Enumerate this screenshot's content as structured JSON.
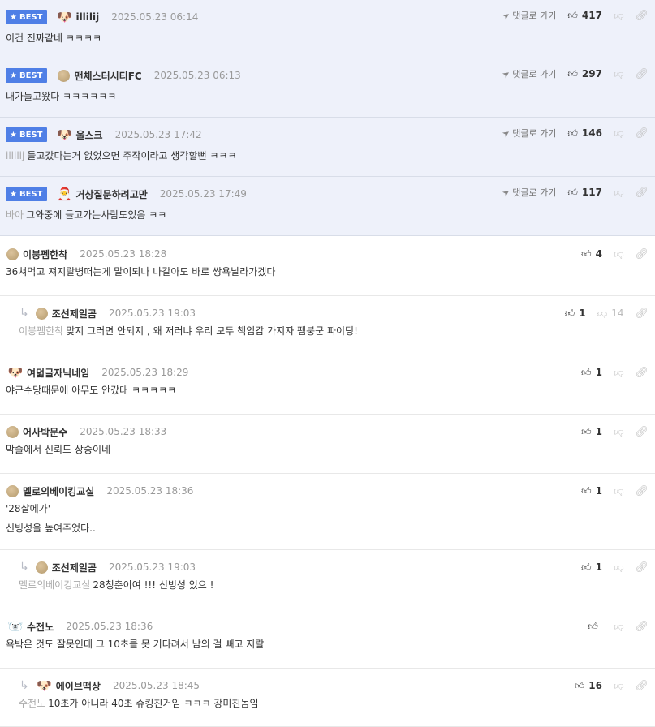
{
  "best_label": "BEST",
  "goto_label": "댓글로 가기",
  "comments": [
    {
      "best": true,
      "nick": "illilij",
      "avatar": "dog-avatar",
      "avatar_glyph": "🐶",
      "date": "2025.05.23 06:14",
      "mention": "",
      "lines": [
        "이건 진짜같네 ㅋㅋㅋㅋ"
      ],
      "up": "417",
      "down": ""
    },
    {
      "best": true,
      "nick": "맨체스터시티FC",
      "avatar": "dot-avatar",
      "avatar_glyph": "",
      "date": "2025.05.23 06:13",
      "mention": "",
      "lines": [
        "내가들고왔다 ㅋㅋㅋㅋㅋㅋ"
      ],
      "up": "297",
      "down": ""
    },
    {
      "best": true,
      "nick": "울스크",
      "avatar": "dog-avatar",
      "avatar_glyph": "🐶",
      "date": "2025.05.23 17:42",
      "mention": "illilij",
      "lines": [
        "들고갔다는거 없었으면 주작이라고 생각할뻔 ㅋㅋㅋ"
      ],
      "up": "146",
      "down": ""
    },
    {
      "best": true,
      "nick": "거상질문하려고만",
      "avatar": "santa-dog-avatar",
      "avatar_glyph": "🎅",
      "date": "2025.05.23 17:49",
      "mention": "바아",
      "lines": [
        "그와중에 들고가는사람도있음 ㅋㅋ"
      ],
      "up": "117",
      "down": ""
    },
    {
      "best": false,
      "reply": false,
      "nick": "이붕펨한착",
      "avatar": "dot-avatar",
      "avatar_glyph": "",
      "date": "2025.05.23 18:28",
      "mention": "",
      "lines": [
        "36쳐먹고 져지랄병떠는게 말이되나 나갈아도 바로 쌍욕날라가겠다"
      ],
      "up": "4",
      "down": ""
    },
    {
      "best": false,
      "reply": true,
      "nick": "조선제일곰",
      "avatar": "dot-avatar",
      "avatar_glyph": "",
      "date": "2025.05.23 19:03",
      "mention": "이붕펨한착",
      "lines": [
        "맞지 그러면 안되지 , 왜 저러냐 우리 모두 책임감 가지자 펨붕군 파이팅!"
      ],
      "up": "1",
      "down": "14"
    },
    {
      "best": false,
      "reply": false,
      "nick": "여덟글자닉네임",
      "avatar": "dog-avatar",
      "avatar_glyph": "🐶",
      "date": "2025.05.23 18:29",
      "mention": "",
      "lines": [
        "야근수당때문에 아무도 안갔대 ㅋㅋㅋㅋㅋ"
      ],
      "up": "1",
      "down": ""
    },
    {
      "best": false,
      "reply": false,
      "nick": "어사박문수",
      "avatar": "dot-avatar",
      "avatar_glyph": "",
      "date": "2025.05.23 18:33",
      "mention": "",
      "lines": [
        "막줄에서 신뢰도 상승이네"
      ],
      "up": "1",
      "down": ""
    },
    {
      "best": false,
      "reply": false,
      "nick": "멜로의베이킹교실",
      "avatar": "dot-avatar",
      "avatar_glyph": "",
      "date": "2025.05.23 18:36",
      "mention": "",
      "lines": [
        "'28살에가'",
        "신빙성을 높여주었다.."
      ],
      "up": "1",
      "down": ""
    },
    {
      "best": false,
      "reply": true,
      "nick": "조선제일곰",
      "avatar": "dot-avatar",
      "avatar_glyph": "",
      "date": "2025.05.23 19:03",
      "mention": "멜로의베이킹교실",
      "lines": [
        "28청춘이여 !!! 신빙성 있으 !"
      ],
      "up": "1",
      "down": ""
    },
    {
      "best": false,
      "reply": false,
      "nick": "수전노",
      "avatar": "polar-bear-avatar",
      "avatar_glyph": "🐻‍❄️",
      "date": "2025.05.23 18:36",
      "mention": "",
      "lines": [
        "욕박은 것도 잘못인데 그 10초를 못 기다려서 남의 걸 빼고 지랄"
      ],
      "up": "",
      "down": ""
    },
    {
      "best": false,
      "reply": true,
      "nick": "에이브떡상",
      "avatar": "dog-avatar",
      "avatar_glyph": "🐶",
      "date": "2025.05.23 18:45",
      "mention": "수전노",
      "lines": [
        "10초가 아니라 40초 슈킹친거임 ㅋㅋㅋ 강미친놈임"
      ],
      "up": "16",
      "down": ""
    }
  ]
}
